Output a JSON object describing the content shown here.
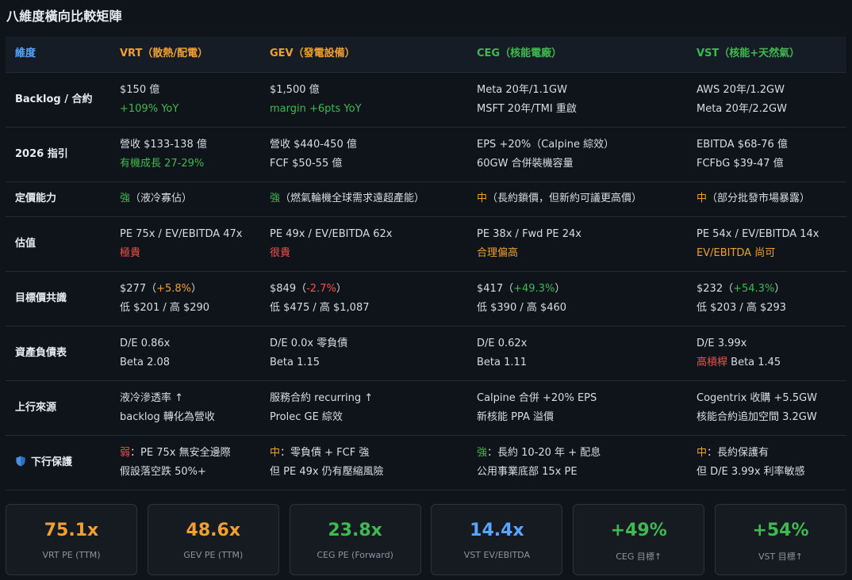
{
  "page_title": "八維度橫向比較矩陣",
  "colors": {
    "orange": "#f0a030",
    "green": "#3fb950",
    "red": "#f85149",
    "blue": "#58a6ff"
  },
  "table": {
    "headers": {
      "dimension": "維度",
      "vrt": "VRT（散熱/配電）",
      "gev": "GEV（發電設備）",
      "ceg": "CEG（核能電廠）",
      "vst": "VST（核能+天然氣）"
    },
    "rows": {
      "backlog": {
        "label": "Backlog / 合約",
        "vrt": [
          "$150 億",
          "+109% YoY"
        ],
        "gev": [
          "$1,500 億",
          "margin +6pts YoY"
        ],
        "ceg": [
          "Meta 20年/1.1GW",
          "MSFT 20年/TMI 重啟"
        ],
        "vst": [
          "AWS 20年/1.2GW",
          "Meta 20年/2.2GW"
        ]
      },
      "guidance": {
        "label": "2026 指引",
        "vrt": [
          "營收 $133-138 億",
          "有機成長 27-29%"
        ],
        "gev": [
          "營收 $440-450 億",
          "FCF $50-55 億"
        ],
        "ceg": [
          "EPS +20%（Calpine 綜效）",
          "60GW 合併裝機容量"
        ],
        "vst": [
          "EBITDA $68-76 億",
          "FCFbG $39-47 億"
        ]
      },
      "pricing": {
        "label": "定價能力",
        "vrt": [
          "強",
          "（液冷寡佔）"
        ],
        "gev": [
          "強",
          "（燃氣輪機全球需求遠超產能）"
        ],
        "ceg": [
          "中",
          "（長約鎖價，但新約可議更高價）"
        ],
        "vst": [
          "中",
          "（部分批發市場暴露）"
        ]
      },
      "valuation": {
        "label": "估值",
        "vrt": [
          "PE 75x / EV/EBITDA 47x",
          "極貴"
        ],
        "gev": [
          "PE 49x / EV/EBITDA 62x",
          "很貴"
        ],
        "ceg": [
          "PE 38x / Fwd PE 24x",
          "合理偏高"
        ],
        "vst": [
          "PE 54x / EV/EBITDA 14x",
          "EV/EBITDA 尚可"
        ]
      },
      "target": {
        "label": "目標價共識",
        "vrt": [
          "$277",
          "（",
          "+5.8%",
          "）",
          "低 $201 / 高 $290"
        ],
        "gev": [
          "$849",
          "（",
          "-2.7%",
          "）",
          "低 $475 / 高 $1,087"
        ],
        "ceg": [
          "$417",
          "（",
          "+49.3%",
          "）",
          "低 $390 / 高 $460"
        ],
        "vst": [
          "$232",
          "（",
          "+54.3%",
          "）",
          "低 $203 / 高 $293"
        ]
      },
      "balance": {
        "label": "資產負債表",
        "vrt": [
          "D/E 0.86x",
          "Beta 2.08"
        ],
        "gev": [
          "D/E 0.0x 零負債",
          "Beta 1.15"
        ],
        "ceg": [
          "D/E 0.62x",
          "Beta 1.11"
        ],
        "vst": [
          "D/E 3.99x",
          "高槓桿",
          " Beta 1.45"
        ]
      },
      "upside": {
        "label": "上行來源",
        "vrt": [
          "液冷滲透率 ↑",
          "backlog 轉化為營收"
        ],
        "gev": [
          "服務合約 recurring ↑",
          "Prolec GE 綜效"
        ],
        "ceg": [
          "Calpine 合併 +20% EPS",
          "新核能 PPA 溢價"
        ],
        "vst": [
          "Cogentrix 收購 +5.5GW",
          "核能合約追加空間 3.2GW"
        ]
      },
      "downside": {
        "label": "下行保護",
        "icon": "shield-icon",
        "vrt": [
          "弱",
          "：PE 75x 無安全邊際",
          "假設落空跌 50%+"
        ],
        "gev": [
          "中",
          "：零負債 + FCF 強",
          "但 PE 49x 仍有壓縮風險"
        ],
        "ceg": [
          "強",
          "：長約 10-20 年 + 配息",
          "公用事業底部 15x PE"
        ],
        "vst": [
          "中",
          "：長約保護有",
          "但 D/E 3.99x 利率敏感"
        ]
      }
    }
  },
  "cards": [
    {
      "value": "75.1x",
      "label": "VRT PE (TTM)",
      "color": "#f0a030"
    },
    {
      "value": "48.6x",
      "label": "GEV PE (TTM)",
      "color": "#f0a030"
    },
    {
      "value": "23.8x",
      "label": "CEG PE (Forward)",
      "color": "#3fb950"
    },
    {
      "value": "14.4x",
      "label": "VST EV/EBITDA",
      "color": "#58a6ff"
    },
    {
      "value": "+49%",
      "label": "CEG 目標↑",
      "color": "#3fb950"
    },
    {
      "value": "+54%",
      "label": "VST 目標↑",
      "color": "#3fb950"
    }
  ]
}
